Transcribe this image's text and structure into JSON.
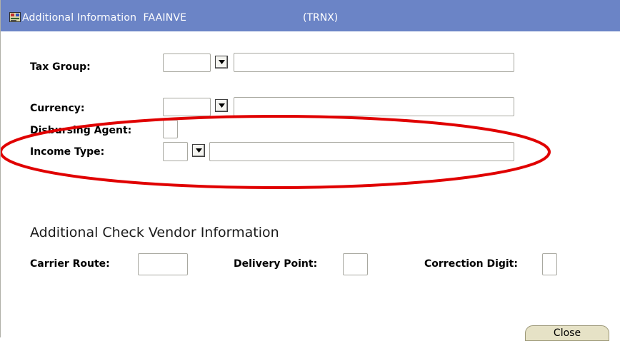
{
  "window": {
    "title": "Additional Information  FAAINVE",
    "code": "(TRNX)"
  },
  "fields": {
    "tax_group": {
      "label": "Tax Group:",
      "code_value": "",
      "description_value": ""
    },
    "currency": {
      "label": "Currency:",
      "code_value": "",
      "description_value": ""
    },
    "disbursing_agent": {
      "label": "Disbursing Agent:",
      "value": ""
    },
    "income_type": {
      "label": "Income Type:",
      "code_value": "",
      "description_value": ""
    }
  },
  "check_vendor": {
    "section_title": "Additional Check Vendor Information",
    "carrier_route": {
      "label": "Carrier Route:",
      "value": ""
    },
    "delivery_point": {
      "label": "Delivery Point:",
      "value": ""
    },
    "correction_digit": {
      "label": "Correction Digit:",
      "value": ""
    }
  },
  "buttons": {
    "close_label": "Close"
  },
  "icons": {
    "window_icon": "form-window-icon",
    "dropdown_icon": "triangle-down-icon"
  },
  "colors": {
    "titlebar": "#6b84c6",
    "annotation_ellipse": "#e00000"
  }
}
